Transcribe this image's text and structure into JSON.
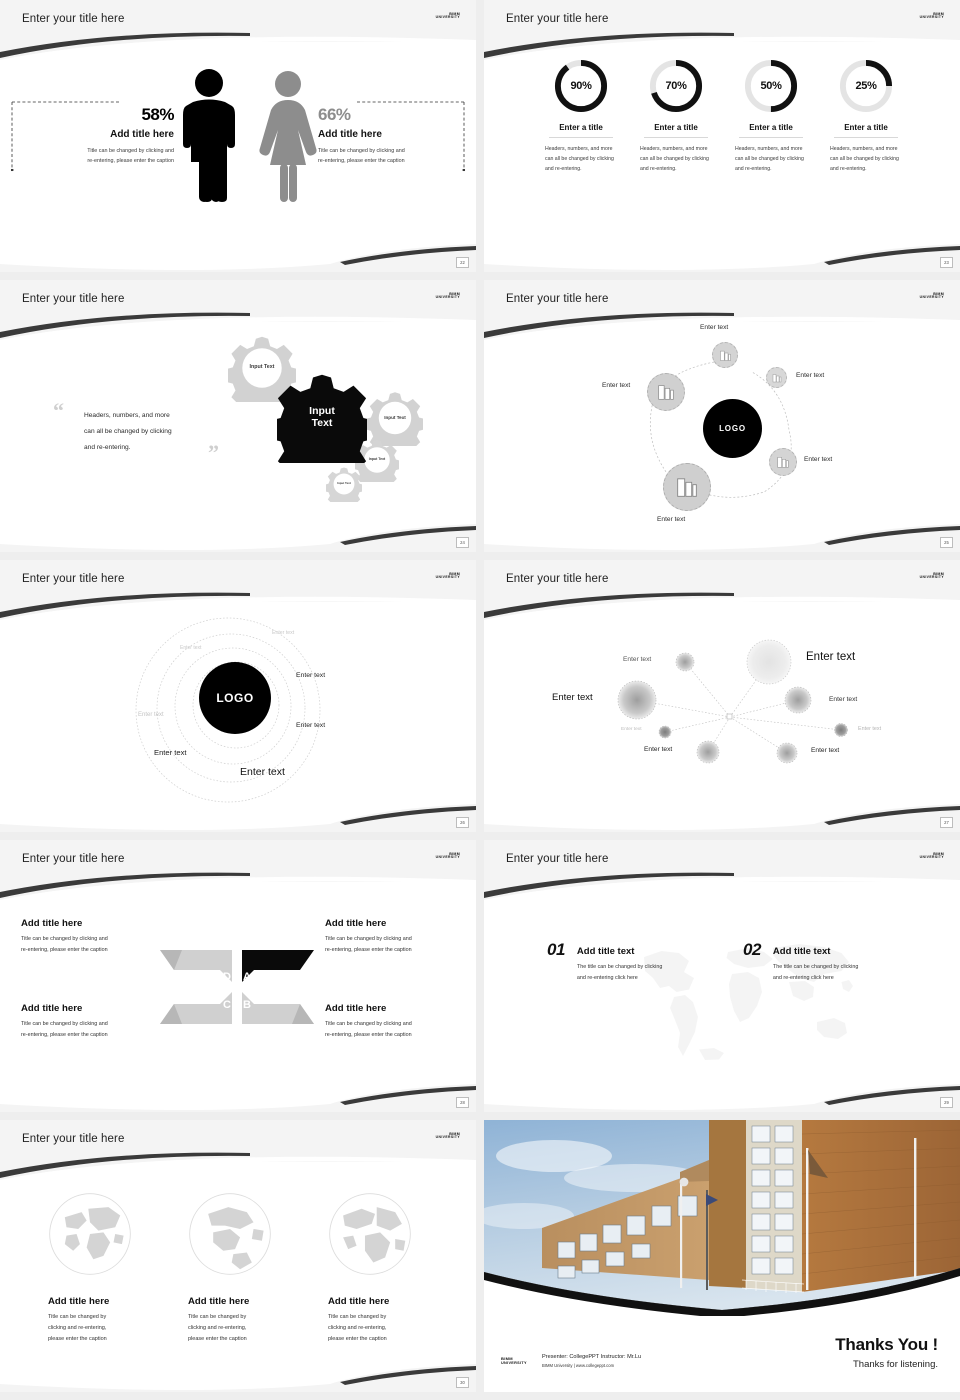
{
  "common": {
    "slide_title": "Enter your title here",
    "logo_line1": "BIMM",
    "logo_line2": "UNIVERSITY"
  },
  "slides": [
    {
      "id": "people-percent",
      "page": "22",
      "title": "Enter your title here",
      "left": {
        "percent": "58%",
        "heading": "Add title here",
        "caption_line1": "Title can be changed by clicking and",
        "caption_line2": "re-entering, please enter the caption"
      },
      "right": {
        "percent": "66%",
        "heading": "Add title here",
        "caption_line1": "Title can be changed by clicking and",
        "caption_line2": "re-entering, please enter the caption"
      },
      "icons": {
        "male": "male-figure-icon",
        "female": "female-figure-icon"
      }
    },
    {
      "id": "donut-percent",
      "page": "23",
      "title": "Enter your title here",
      "items": [
        {
          "value": "90%",
          "pct": 90,
          "title": "Enter a title",
          "desc": "Headers, numbers, and more can all be changed by clicking and re-entering."
        },
        {
          "value": "70%",
          "pct": 70,
          "title": "Enter a title",
          "desc": "Headers, numbers, and more can all be changed by clicking and re-entering."
        },
        {
          "value": "50%",
          "pct": 50,
          "title": "Enter a title",
          "desc": "Headers, numbers, and more can all be changed by clicking and re-entering."
        },
        {
          "value": "25%",
          "pct": 25,
          "title": "Enter a title",
          "desc": "Headers, numbers, and more can all be changed by clicking and re-entering."
        }
      ]
    },
    {
      "id": "gears-quote",
      "page": "24",
      "title": "Enter your title here",
      "quote_open": "“",
      "quote_close": "”",
      "quote_line1": "Headers, numbers, and more",
      "quote_line2": "can all be changed by clicking",
      "quote_line3": "and re-entering.",
      "gears": [
        {
          "label": "Input Text",
          "size": "large-dark"
        },
        {
          "label": "Input Text",
          "size": "medium"
        },
        {
          "label": "Input Text",
          "size": "medium"
        },
        {
          "label": "Input Text",
          "size": "small"
        },
        {
          "label": "Input Text",
          "size": "xsmall"
        }
      ]
    },
    {
      "id": "logo-hub-buildings",
      "page": "25",
      "title": "Enter your title here",
      "center_label": "LOGO",
      "nodes": [
        {
          "label": "Enter text",
          "icon": "building-icon"
        },
        {
          "label": "Enter text",
          "icon": "building-icon"
        },
        {
          "label": "Enter text",
          "icon": "building-icon"
        },
        {
          "label": "Enter text",
          "icon": "building-icon"
        },
        {
          "label": "Enter text",
          "icon": "building-icon"
        }
      ]
    },
    {
      "id": "concentric-logo",
      "page": "26",
      "title": "Enter your title here",
      "center_label": "LOGO",
      "labels": [
        "Enter text",
        "Enter text",
        "Enter text",
        "Enter text",
        "Enter text",
        "Enter text",
        "Enter text"
      ]
    },
    {
      "id": "radial-nodes",
      "page": "27",
      "title": "Enter your title here",
      "nodes": [
        {
          "label": "Enter text"
        },
        {
          "label": "Enter text"
        },
        {
          "label": "Enter text"
        },
        {
          "label": "Enter text"
        },
        {
          "label": "Enter text"
        },
        {
          "label": "Enter text"
        },
        {
          "label": "Enter text"
        },
        {
          "label": "Enter text"
        }
      ]
    },
    {
      "id": "x-arrows-quadrants",
      "page": "28",
      "title": "Enter your title here",
      "letters": [
        "A",
        "B",
        "C",
        "D"
      ],
      "blocks": [
        {
          "heading": "Add title here",
          "caption_line1": "Title can be changed by clicking and",
          "caption_line2": "re-entering, please enter the caption"
        },
        {
          "heading": "Add title here",
          "caption_line1": "Title can be changed by clicking and",
          "caption_line2": "re-entering, please enter the caption"
        },
        {
          "heading": "Add title here",
          "caption_line1": "Title can be changed by clicking and",
          "caption_line2": "re-entering, please enter the caption"
        },
        {
          "heading": "Add title here",
          "caption_line1": "Title can be changed by clicking and",
          "caption_line2": "re-entering, please enter the caption"
        }
      ]
    },
    {
      "id": "numbered-worldmap",
      "page": "29",
      "title": "Enter your title here",
      "items": [
        {
          "number": "01",
          "heading": "Add title text",
          "caption_line1": "The title can be changed by clicking",
          "caption_line2": "and re-entering click here"
        },
        {
          "number": "02",
          "heading": "Add title text",
          "caption_line1": "The title can be changed by clicking",
          "caption_line2": "and re-entering click here"
        }
      ]
    },
    {
      "id": "three-globes",
      "page": "30",
      "title": "Enter your title here",
      "items": [
        {
          "heading": "Add title here",
          "caption_line1": "Title can be changed by",
          "caption_line2": "clicking and re-entering,",
          "caption_line3": "please enter the caption"
        },
        {
          "heading": "Add title here",
          "caption_line1": "Title can be changed by",
          "caption_line2": "clicking and re-entering,",
          "caption_line3": "please enter the caption"
        },
        {
          "heading": "Add title here",
          "caption_line1": "Title can be changed by",
          "caption_line2": "clicking and re-entering,",
          "caption_line3": "please enter the caption"
        }
      ]
    },
    {
      "id": "thanks-closing",
      "page": "31",
      "thanks_title": "Thanks You !",
      "thanks_sub": "Thanks for listening.",
      "presenter_line": "Presenter: CollegePPT   Instructor: Mr.Lu",
      "source_line": "BIMM University  |  www.collegeppt.com",
      "logo_line1": "BIMM",
      "logo_line2": "UNIVERSITY"
    }
  ]
}
